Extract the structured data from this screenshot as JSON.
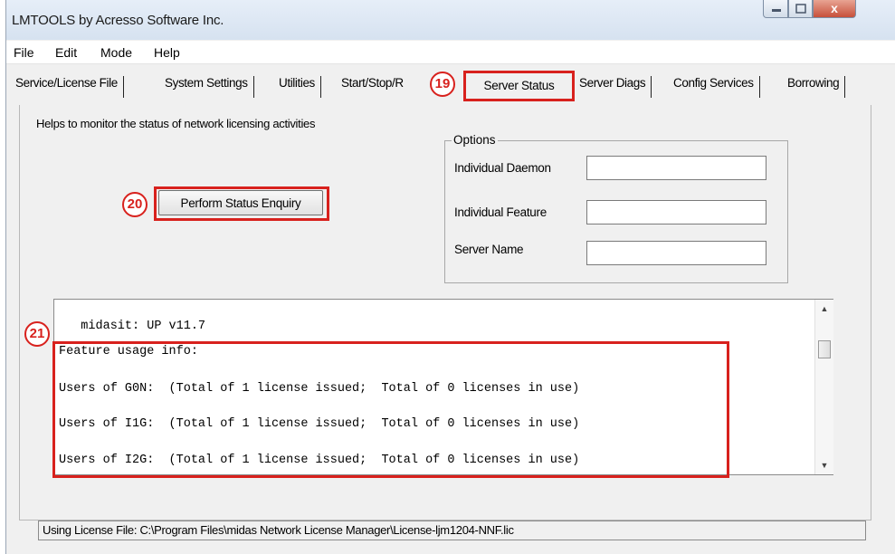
{
  "window": {
    "title": "LMTOOLS by Acresso Software Inc.",
    "controls": {
      "minimize_icon": "minimize-icon",
      "maximize_icon": "maximize-icon",
      "close_glyph": "x"
    }
  },
  "menu": [
    "File",
    "Edit",
    "Mode",
    "Help"
  ],
  "tabs": [
    {
      "label": "Service/License File"
    },
    {
      "label": "System Settings"
    },
    {
      "label": "Utilities"
    },
    {
      "label": "Start/Stop/R"
    },
    {
      "label": "Server Status",
      "active": true
    },
    {
      "label": "Server Diags"
    },
    {
      "label": "Config Services"
    },
    {
      "label": "Borrowing"
    }
  ],
  "panel": {
    "description": "Helps to monitor the status of network licensing activities",
    "enquiry_button": "Perform Status Enquiry",
    "options": {
      "legend": "Options",
      "fields": [
        {
          "label": "Individual Daemon",
          "value": ""
        },
        {
          "label": "Individual Feature",
          "value": ""
        },
        {
          "label": "Server Name",
          "value": ""
        }
      ]
    }
  },
  "output_lines": [
    "   midasit: UP v11.7",
    "Feature usage info:",
    "Users of G0N:  (Total of 1 license issued;  Total of 0 licenses in use)",
    "Users of I1G:  (Total of 1 license issued;  Total of 0 licenses in use)",
    "Users of I2G:  (Total of 1 license issued;  Total of 0 licenses in use)"
  ],
  "annotations": [
    "19",
    "20",
    "21"
  ],
  "status_bar": "Using License File:  C:\\Program Files\\midas Network License Manager\\License-ljm1204-NNF.lic",
  "colors": {
    "highlight": "#d8211d",
    "background": "#f0f0f0"
  }
}
